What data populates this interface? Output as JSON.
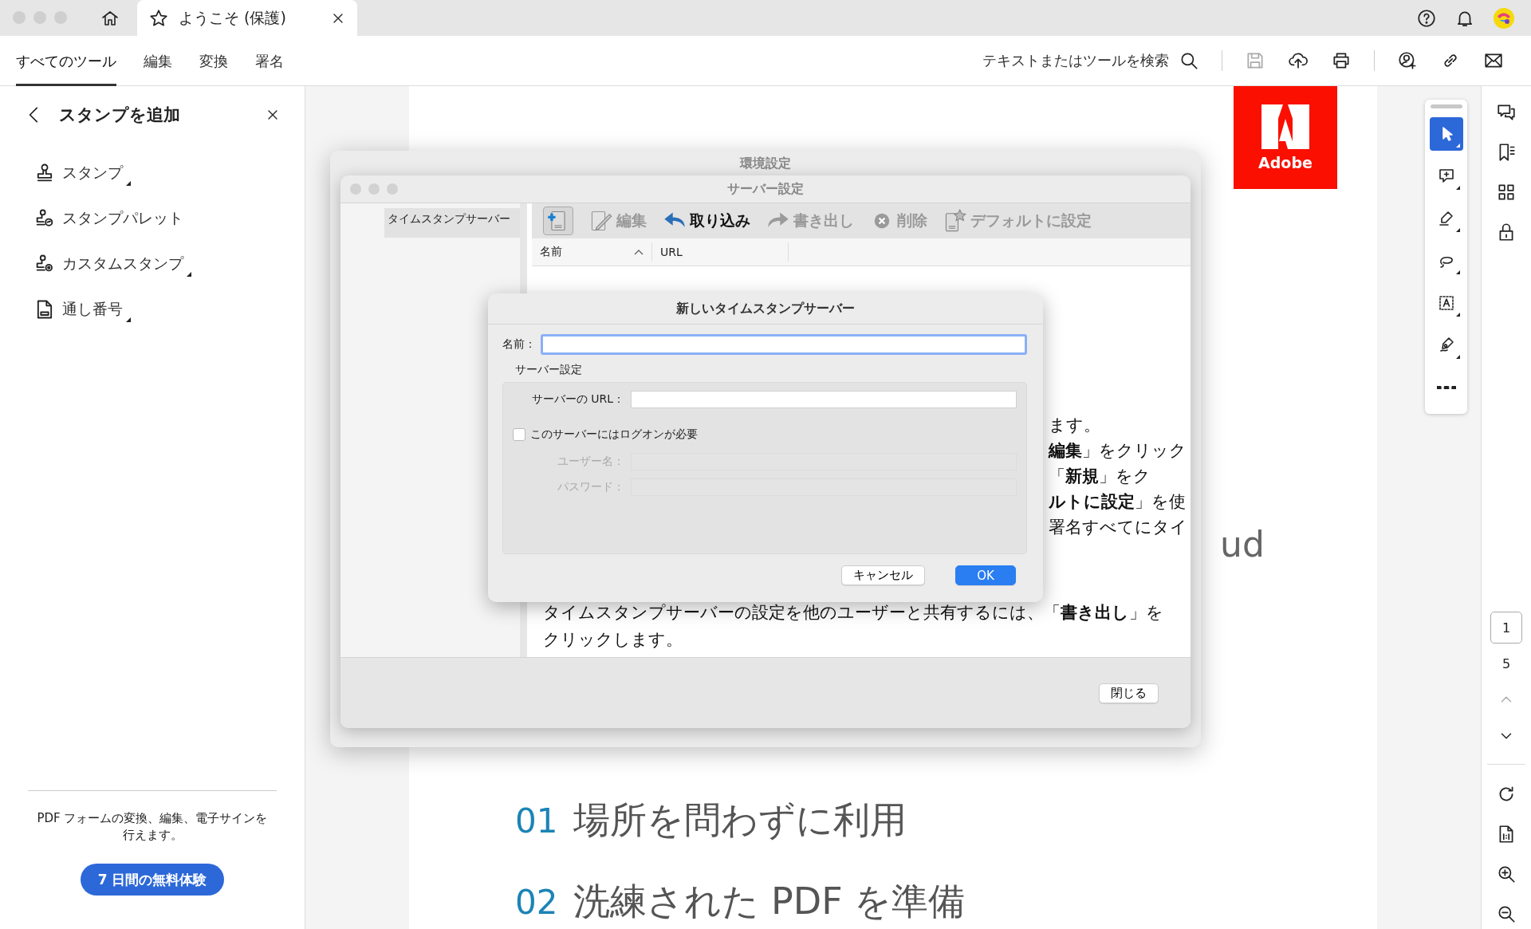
{
  "browser_tab": {
    "title": "ようこそ (保護)"
  },
  "menu_tabs": [
    {
      "label": "すべてのツール",
      "selected": true
    },
    {
      "label": "編集",
      "selected": false
    },
    {
      "label": "変換",
      "selected": false
    },
    {
      "label": "署名",
      "selected": false
    }
  ],
  "search": {
    "label": "テキストまたはツールを検索"
  },
  "toolbar_actions": [
    {
      "kind": "save",
      "disabled": true
    },
    {
      "kind": "upload",
      "disabled": false
    },
    {
      "kind": "print",
      "disabled": false
    },
    {
      "kind": "share",
      "disabled": false
    },
    {
      "kind": "link",
      "disabled": false
    },
    {
      "kind": "mail",
      "disabled": false
    }
  ],
  "side_panel": {
    "title": "スタンプを追加",
    "items": [
      {
        "kind": "stamp",
        "label": "スタンプ",
        "submenu": true
      },
      {
        "kind": "palette",
        "label": "スタンプパレット",
        "submenu": false
      },
      {
        "kind": "custom",
        "label": "カスタムスタンプ",
        "submenu": true
      },
      {
        "kind": "numbering",
        "label": "通し番号",
        "submenu": true
      }
    ],
    "promo_text": "PDF フォームの変換、編集、電子サインを行えます。",
    "trial_button": "7 日間の無料体験"
  },
  "document": {
    "logo_text": "Adobe",
    "partial_heading": "ud",
    "features": [
      {
        "number": "01",
        "text": "場所を問わずに利用"
      },
      {
        "number": "02",
        "text": "洗練された PDF を準備"
      }
    ]
  },
  "preferences_window": {
    "title": "環境設定"
  },
  "server_window": {
    "title": "サーバー設定",
    "categories": [
      {
        "label": "タイムスタンプサーバー",
        "selected": true
      }
    ],
    "toolbar": [
      {
        "kind": "add",
        "selected": true,
        "disabled": false
      },
      {
        "kind": "edit",
        "label": "編集",
        "selected": false,
        "disabled": true
      },
      {
        "kind": "import",
        "label": "取り込み",
        "selected": false,
        "disabled": false
      },
      {
        "kind": "export",
        "label": "書き出し",
        "selected": false,
        "disabled": true
      },
      {
        "kind": "delete",
        "label": "削除",
        "selected": false,
        "disabled": true
      },
      {
        "kind": "default",
        "label": "デフォルトに設定",
        "selected": false,
        "disabled": true
      }
    ],
    "columns": [
      {
        "label": "名前",
        "sorted": true
      },
      {
        "label": "URL",
        "sorted": false
      }
    ],
    "background_fragments": [
      "ます。",
      "**編集**」をクリック",
      "「**新規**」をク",
      "**ルトに設定**」を使",
      "署名すべてにタイ"
    ],
    "background_paragraph": "タイムスタンプサーバーの設定を他のユーザーと共有するには、「**書き出し**」をクリックします。",
    "close_button": "閉じる"
  },
  "new_server_dialog": {
    "title": "新しいタイムスタンプサーバー",
    "name_label": "名前：",
    "name_focused": true,
    "group_label": "サーバー設定",
    "url_label": "サーバーの URL：",
    "logon": {
      "label": "このサーバーにはログオンが必要",
      "checked": false
    },
    "username_label": "ユーザー名：",
    "password_label": "パスワード：",
    "cancel_button": "キャンセル",
    "ok_button": "OK"
  },
  "tools": [
    {
      "kind": "select",
      "selected": true
    },
    {
      "kind": "comment",
      "selected": false
    },
    {
      "kind": "highlight",
      "selected": false
    },
    {
      "kind": "lasso",
      "selected": false
    },
    {
      "kind": "text-select",
      "selected": false
    },
    {
      "kind": "sign",
      "selected": false
    },
    {
      "kind": "more",
      "selected": false
    }
  ],
  "rail": {
    "panels": [
      {
        "kind": "comments"
      },
      {
        "kind": "bookmarks"
      },
      {
        "kind": "pages"
      },
      {
        "kind": "protect"
      }
    ],
    "page_current": "1",
    "page_total": "5",
    "prev_disabled": true
  }
}
